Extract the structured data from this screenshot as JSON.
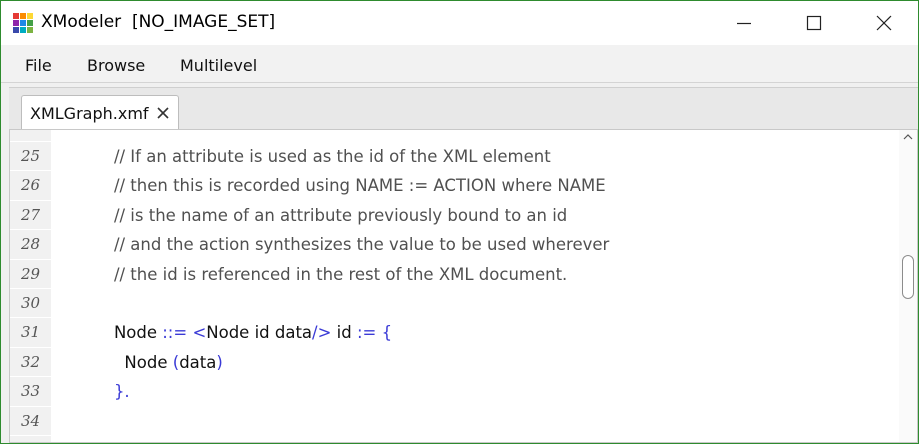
{
  "window": {
    "title": "XModeler  [NO_IMAGE_SET]",
    "icon": "app-grid-icon",
    "controls": [
      "minimize-icon",
      "maximize-icon",
      "close-icon"
    ]
  },
  "menu": {
    "items": [
      "File",
      "Browse",
      "Multilevel"
    ]
  },
  "tabs": [
    {
      "label": "XMLGraph.xmf",
      "close_icon": "close-icon"
    }
  ],
  "editor": {
    "lines": [
      {
        "num": "25",
        "segments": [
          {
            "t": "            // If an attribute is used as the id of the XML element",
            "c": "comment"
          }
        ]
      },
      {
        "num": "26",
        "segments": [
          {
            "t": "            // then this is recorded using NAME := ACTION where NAME",
            "c": "comment"
          }
        ]
      },
      {
        "num": "27",
        "segments": [
          {
            "t": "            // is the name of an attribute previously bound to an id",
            "c": "comment"
          }
        ]
      },
      {
        "num": "28",
        "segments": [
          {
            "t": "            // and the action synthesizes the value to be used wherever",
            "c": "comment"
          }
        ]
      },
      {
        "num": "29",
        "segments": [
          {
            "t": "            // the id is referenced in the rest of the XML document.",
            "c": "comment"
          }
        ]
      },
      {
        "num": "30",
        "segments": []
      },
      {
        "num": "31",
        "segments": [
          {
            "t": "            Node ",
            "c": "kw"
          },
          {
            "t": "::= <",
            "c": "op"
          },
          {
            "t": "Node id data",
            "c": "kw"
          },
          {
            "t": "/>",
            "c": "op"
          },
          {
            "t": " id ",
            "c": "kw"
          },
          {
            "t": ":= {",
            "c": "op"
          }
        ]
      },
      {
        "num": "32",
        "segments": [
          {
            "t": "              Node ",
            "c": "kw"
          },
          {
            "t": "(",
            "c": "op"
          },
          {
            "t": "data",
            "c": "kw"
          },
          {
            "t": ")",
            "c": "op"
          }
        ]
      },
      {
        "num": "33",
        "segments": [
          {
            "t": "            }.",
            "c": "op"
          }
        ]
      },
      {
        "num": "34",
        "segments": []
      }
    ]
  },
  "colors": {
    "window_border": "#2e8b2e",
    "operator": "#3a3ad6",
    "comment": "#505050"
  }
}
